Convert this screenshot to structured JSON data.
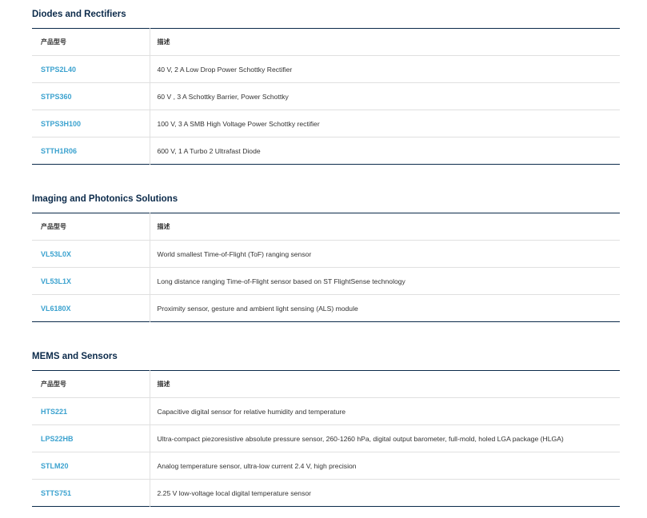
{
  "sections": [
    {
      "title": "Diodes and Rectifiers",
      "header": {
        "part": "产品型号",
        "desc": "描述"
      },
      "rows": [
        {
          "part": "STPS2L40",
          "desc": "40 V, 2 A Low Drop Power Schottky Rectifier"
        },
        {
          "part": "STPS360",
          "desc": "60 V , 3 A Schottky Barrier, Power Schottky"
        },
        {
          "part": "STPS3H100",
          "desc": "100 V, 3 A SMB High Voltage Power Schottky rectifier"
        },
        {
          "part": "STTH1R06",
          "desc": "600 V, 1 A Turbo 2 Ultrafast Diode"
        }
      ]
    },
    {
      "title": "Imaging and Photonics Solutions",
      "header": {
        "part": "产品型号",
        "desc": "描述"
      },
      "rows": [
        {
          "part": "VL53L0X",
          "desc": "World smallest Time-of-Flight (ToF) ranging sensor"
        },
        {
          "part": "VL53L1X",
          "desc": "Long distance ranging Time-of-Flight sensor based on ST FlightSense technology"
        },
        {
          "part": "VL6180X",
          "desc": "Proximity sensor, gesture and ambient light sensing (ALS) module"
        }
      ]
    },
    {
      "title": "MEMS and Sensors",
      "header": {
        "part": "产品型号",
        "desc": "描述"
      },
      "rows": [
        {
          "part": "HTS221",
          "desc": "Capacitive digital sensor for relative humidity and temperature"
        },
        {
          "part": "LPS22HB",
          "desc": "Ultra-compact piezoresistive absolute pressure sensor, 260-1260 hPa, digital output barometer, full-mold, holed LGA package (HLGA)"
        },
        {
          "part": "STLM20",
          "desc": "Analog temperature sensor, ultra-low current 2.4 V, high precision"
        },
        {
          "part": "STTS751",
          "desc": "2.25 V low-voltage local digital temperature sensor"
        }
      ]
    }
  ]
}
